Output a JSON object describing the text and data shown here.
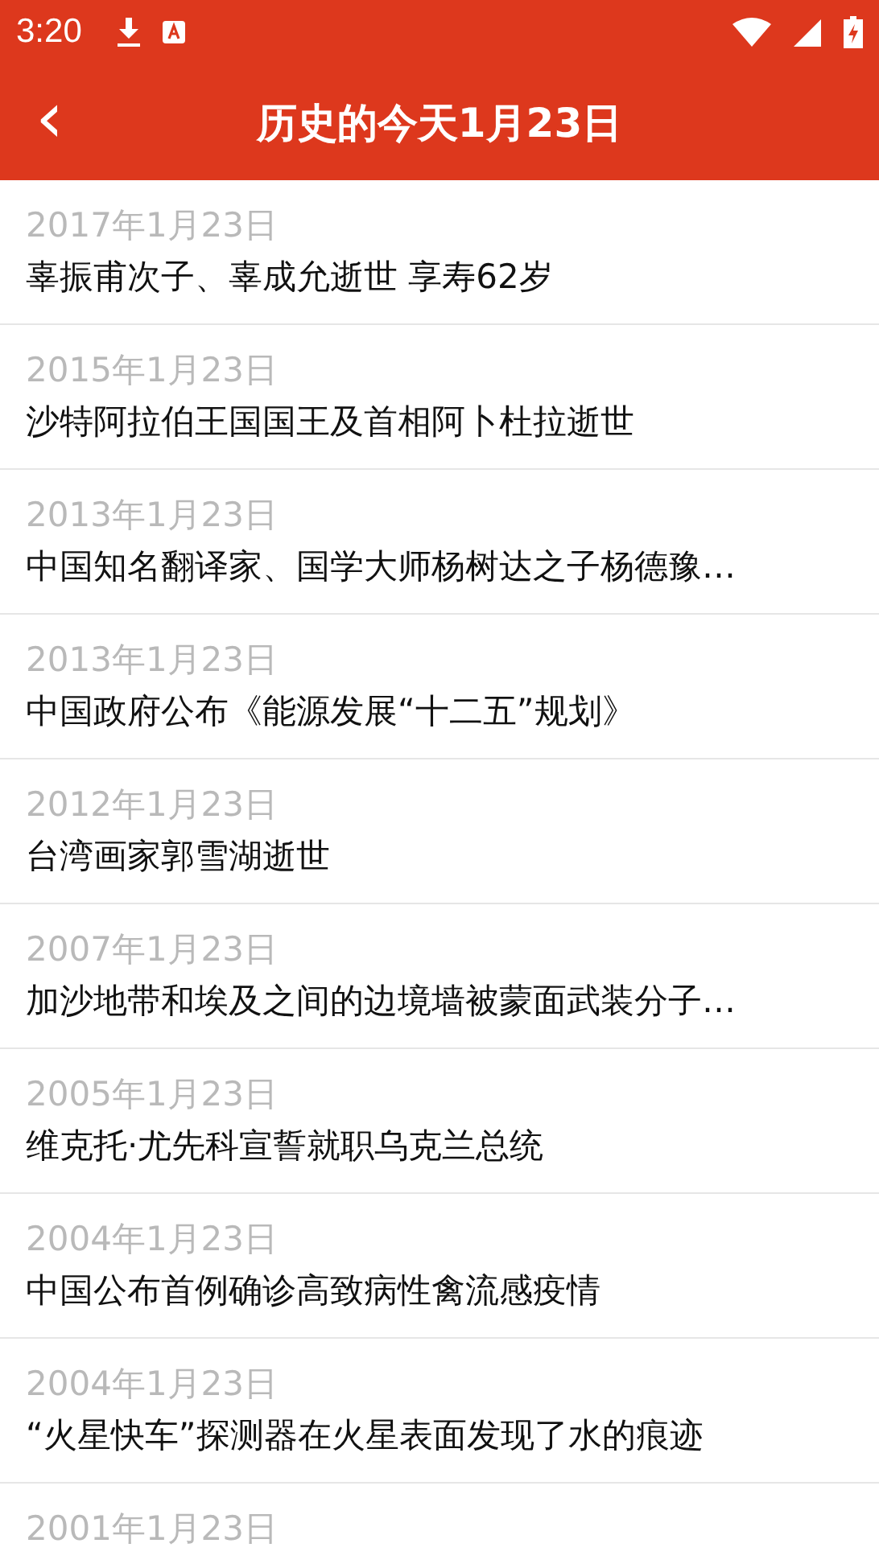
{
  "status_bar": {
    "time": "3:20"
  },
  "header": {
    "back": "‹",
    "title": "历史的今天1月23日"
  },
  "events": [
    {
      "date": "2017年1月23日",
      "title": "辜振甫次子、辜成允逝世  享寿62岁"
    },
    {
      "date": "2015年1月23日",
      "title": "沙特阿拉伯王国国王及首相阿卜杜拉逝世"
    },
    {
      "date": "2013年1月23日",
      "title": "中国知名翻译家、国学大师杨树达之子杨德豫…"
    },
    {
      "date": "2013年1月23日",
      "title": "中国政府公布《能源发展“十二五”规划》"
    },
    {
      "date": "2012年1月23日",
      "title": "台湾画家郭雪湖逝世"
    },
    {
      "date": "2007年1月23日",
      "title": "加沙地带和埃及之间的边境墙被蒙面武装分子…"
    },
    {
      "date": "2005年1月23日",
      "title": "维克托·尤先科宣誓就职乌克兰总统"
    },
    {
      "date": "2004年1月23日",
      "title": "中国公布首例确诊高致病性禽流感疫情"
    },
    {
      "date": "2004年1月23日",
      "title": "“火星快车”探测器在火星表面发现了水的痕迹"
    },
    {
      "date": "2001年1月23日"
    }
  ]
}
